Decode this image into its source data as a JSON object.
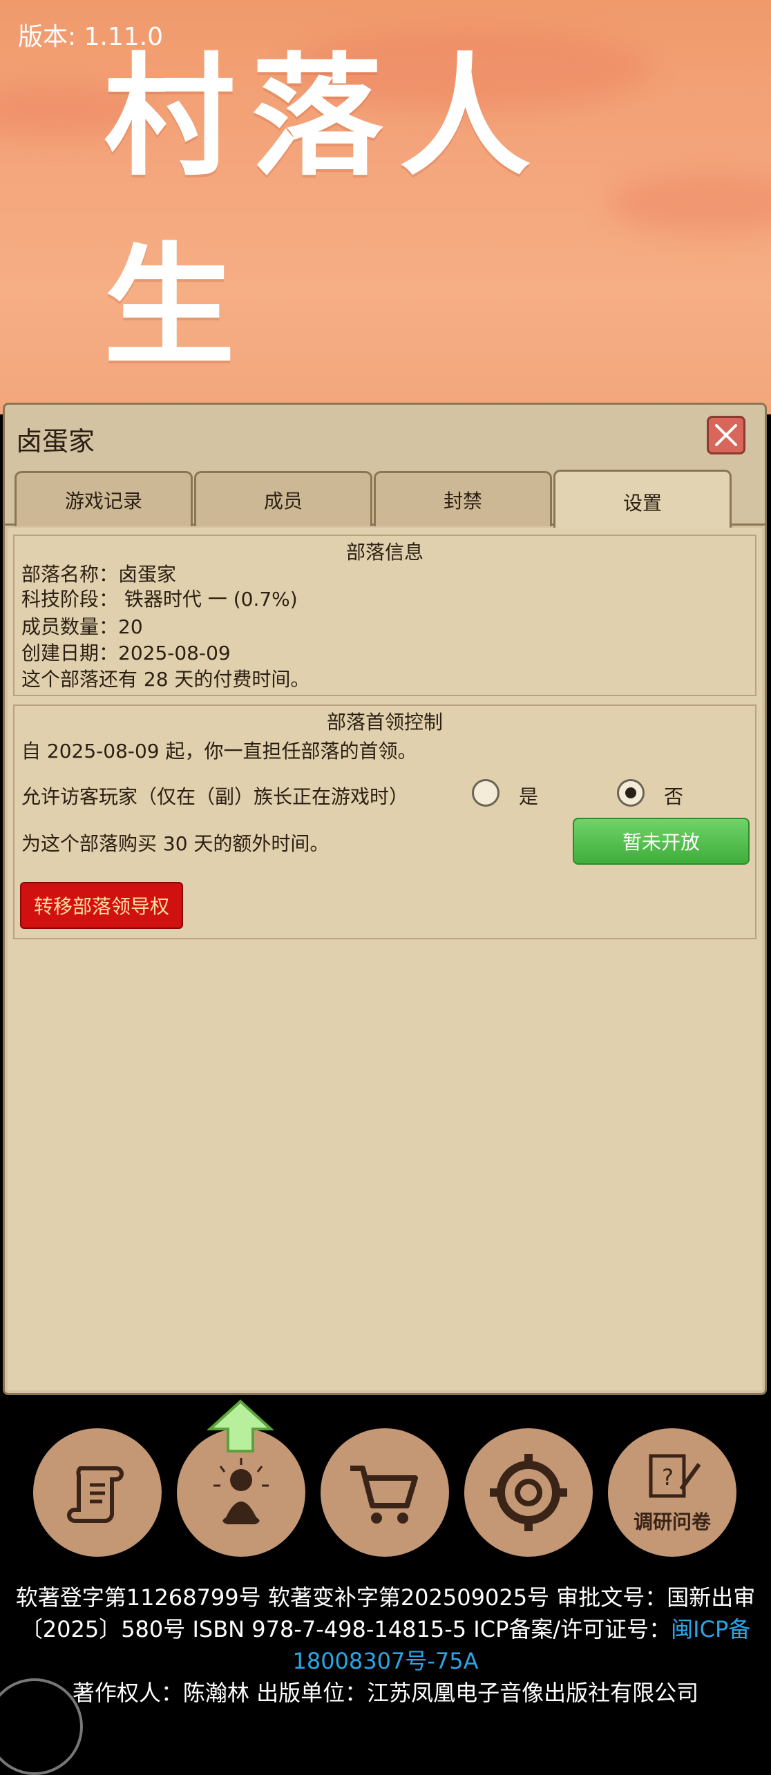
{
  "version": "版本: 1.11.0",
  "logo_text": "村落人生",
  "dialog": {
    "title": "卤蛋家",
    "tabs": [
      {
        "label": "游戏记录"
      },
      {
        "label": "成员"
      },
      {
        "label": "封禁"
      },
      {
        "label": "设置"
      }
    ],
    "active_tab": "设置"
  },
  "tribe_info": {
    "title": "部落信息",
    "name_line": "部落名称：卤蛋家",
    "tech_line": "科技阶段： 铁器时代 一 (0.7%)",
    "members_line": "成员数量：20",
    "created_line": "创建日期：2025-08-09",
    "paid_line": "这个部落还有 28 天的付费时间。"
  },
  "leader_control": {
    "title": "部落首领控制",
    "since_line": "自 2025-08-09 起，你一直担任部落的首领。",
    "visitor_line": "允许访客玩家（仅在（副）族长正在游戏时）",
    "yes_label": "是",
    "no_label": "否",
    "selected": "否",
    "buy_line": "为这个部落购买 30 天的额外时间。",
    "buy_button": "暂未开放",
    "transfer_button": "转移部落领导权"
  },
  "nav": {
    "survey_label": "调研问卷"
  },
  "footer": {
    "line1": "软著登字第11268799号 软著变补字第202509025号 审批文号：国新出审",
    "line2a": "〔2025〕580号 ISBN 978-7-498-14815-5 ICP备案/许可证号：",
    "line2b": "闽ICP备",
    "line3": "18008307号-75A",
    "line4": "著作权人：陈瀚林 出版单位：江苏凤凰电子音像出版社有限公司"
  },
  "colors": {
    "sky": "#f4a47a",
    "dialog_bg": "#e0d0ae",
    "buy_button": "#4cbf47",
    "transfer_button": "#d11010",
    "close_button": "#d9665a",
    "nav_button": "#c49775",
    "link": "#2aa6e6"
  }
}
